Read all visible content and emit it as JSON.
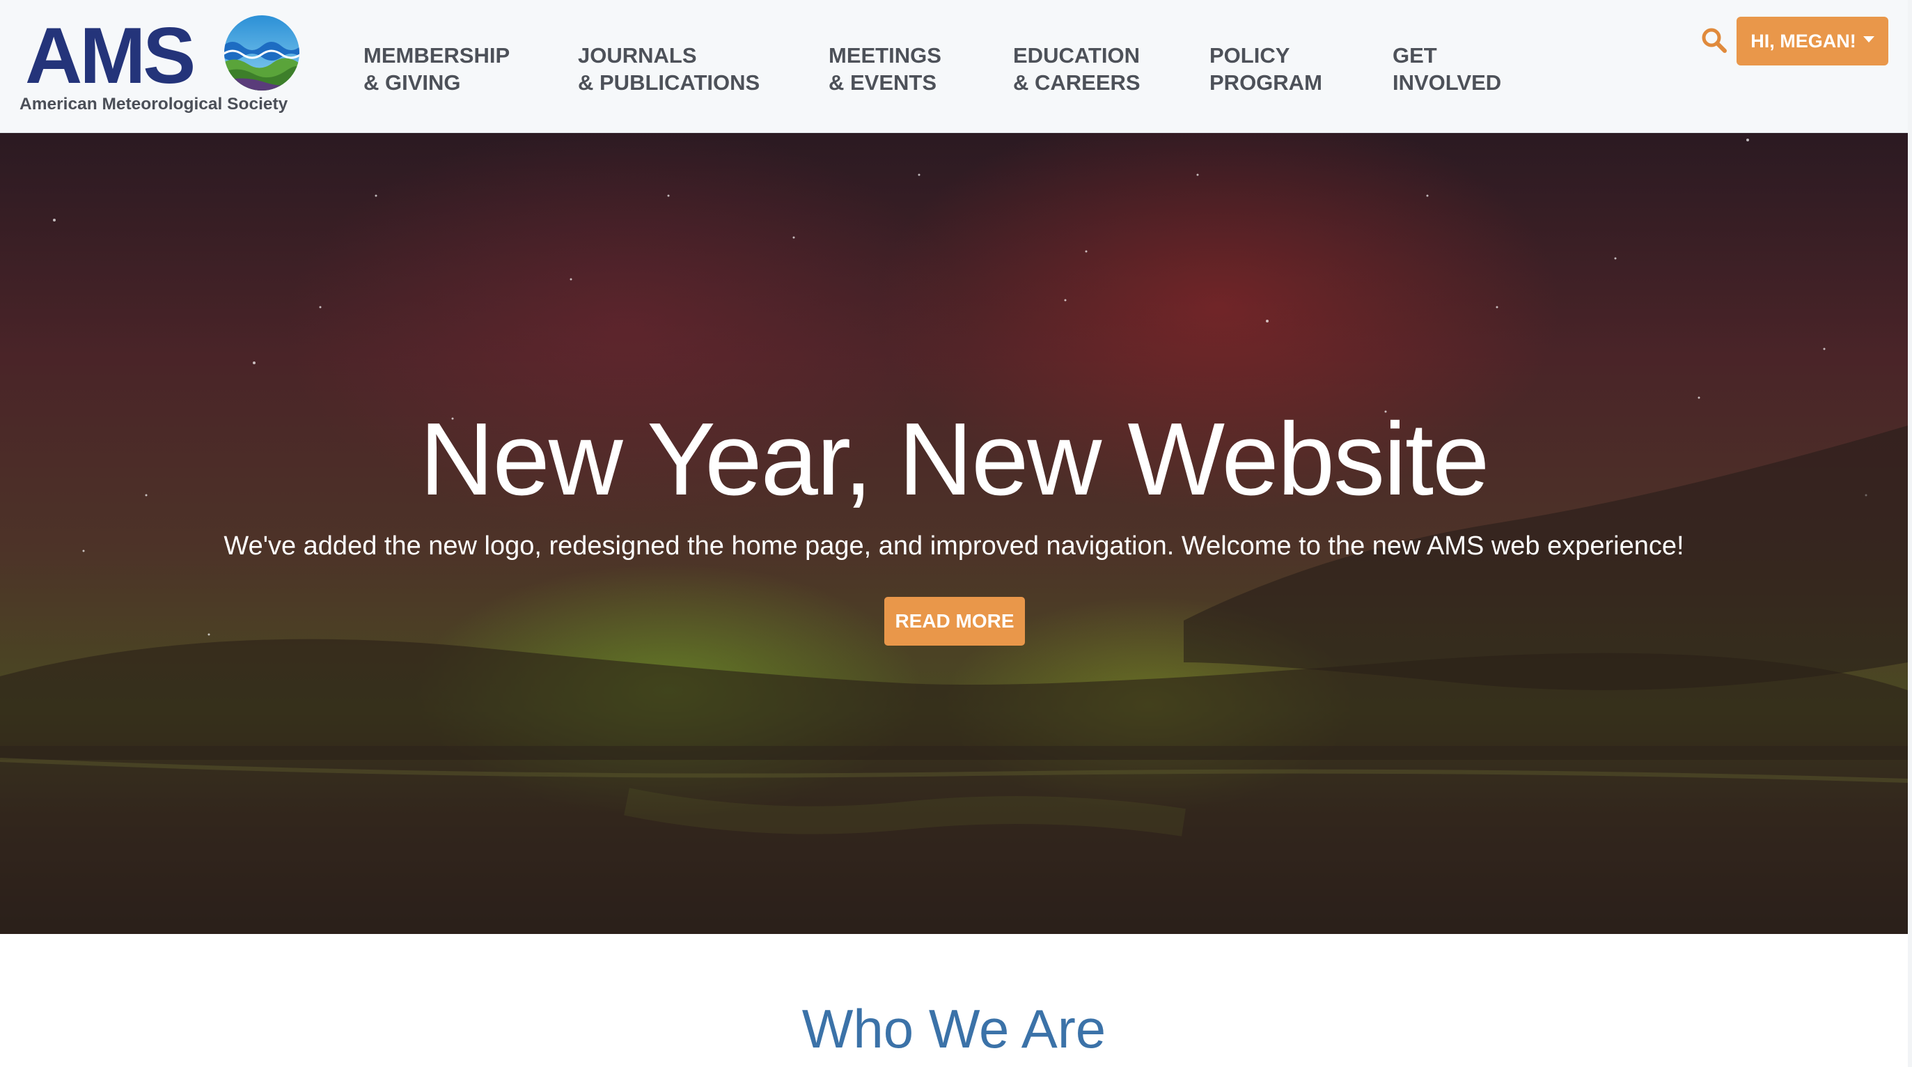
{
  "header": {
    "logo_text": "AMS",
    "logo_subtitle": "American Meteorological Society",
    "nav": [
      {
        "line1": "Membership",
        "line2": "& Giving"
      },
      {
        "line1": "Journals",
        "line2": "& Publications"
      },
      {
        "line1": "Meetings",
        "line2": "& Events"
      },
      {
        "line1": "Education",
        "line2": "& Careers"
      },
      {
        "line1": "Policy",
        "line2": "Program"
      },
      {
        "line1": "Get",
        "line2": "Involved"
      }
    ],
    "search_icon": "search-icon",
    "user_button_label": "HI, MEGAN!"
  },
  "hero": {
    "title": "New Year, New Website",
    "subtitle": "We've added the new logo, redesigned the home page, and improved navigation. Welcome to the new AMS web experience!",
    "button_label": "READ MORE"
  },
  "section": {
    "title": "Who We Are"
  },
  "colors": {
    "brand_blue": "#24347a",
    "accent_orange": "#e9974a",
    "heading_blue": "#3b72a8",
    "nav_text": "#4d5159"
  }
}
